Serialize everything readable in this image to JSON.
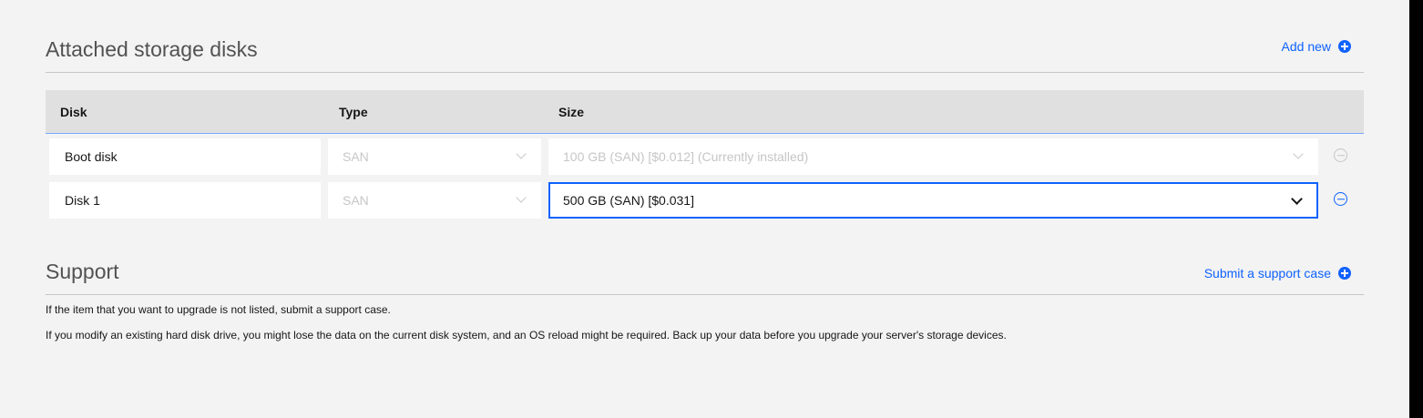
{
  "storage": {
    "title": "Attached storage disks",
    "add_label": "Add new",
    "columns": {
      "disk": "Disk",
      "type": "Type",
      "size": "Size"
    },
    "rows": [
      {
        "disk": "Boot disk",
        "type": "SAN",
        "size": "100 GB (SAN) [$0.012] (Currently installed)",
        "disabled": true
      },
      {
        "disk": "Disk 1",
        "type": "SAN",
        "size": "500 GB (SAN) [$0.031]",
        "disabled": false
      }
    ]
  },
  "support": {
    "title": "Support",
    "action_label": "Submit a support case",
    "lines": [
      "If the item that you want to upgrade is not listed, submit a support case.",
      "If you modify an existing hard disk drive, you might lose the data on the current disk system, and an OS reload might be required. Back up your data before you upgrade your server's storage devices."
    ]
  },
  "colors": {
    "accent": "#0f62fe",
    "background": "#f3f3f3",
    "header": "#e0e0e0",
    "disabled": "#c6c6c6"
  },
  "icons": {
    "add": "plus-circle-icon",
    "remove": "minus-circle-icon",
    "dropdown": "chevron-down-icon"
  }
}
